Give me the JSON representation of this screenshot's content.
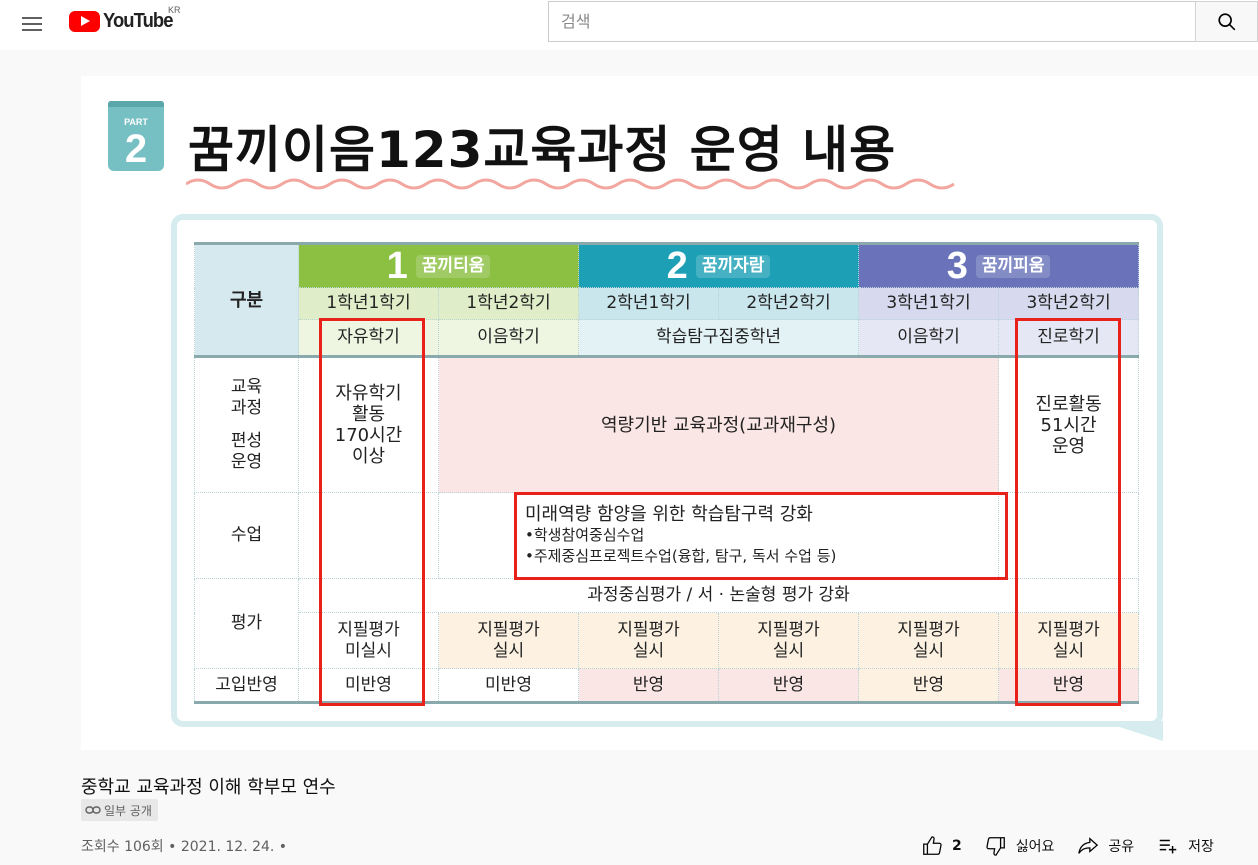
{
  "header": {
    "logo_text": "YouTube",
    "country_code": "KR",
    "search_placeholder": "검색"
  },
  "slide": {
    "part_label": "PART",
    "part_number": "2",
    "title": "꿈끼이음123교육과정 운영 내용",
    "table": {
      "corner": "구분",
      "grades": [
        {
          "num": "1",
          "name": "꿈끼티움"
        },
        {
          "num": "2",
          "name": "꿈끼자람"
        },
        {
          "num": "3",
          "name": "꿈끼피움"
        }
      ],
      "semesters": [
        "1학년1학기",
        "1학년2학기",
        "2학년1학기",
        "2학년2학기",
        "3학년1학기",
        "3학년2학기"
      ],
      "semester_types": [
        "자유학기",
        "이음학기",
        "학습탐구집중학년",
        "이음학기",
        "진로학기"
      ],
      "row_curriculum": {
        "label_line1": "교육",
        "label_line2": "과정",
        "label_line3": "편성",
        "label_line4": "운영",
        "free_sem": [
          "자유학기",
          "활동",
          "170시간",
          "이상"
        ],
        "center": "역량기반 교육과정(교과재구성)",
        "career": [
          "진로활동",
          "51시간",
          "운영"
        ]
      },
      "row_class": {
        "label": "수업",
        "heading": "미래역량 함양을 위한 학습탐구력 강화",
        "bullet1": "•학생참여중심수업",
        "bullet2": "•주제중심프로젝트수업(융합, 탐구, 독서 수업 등)"
      },
      "row_eval": {
        "label": "평가",
        "banner": "과정중심평가 / 서 · 논술형 평가 강화",
        "cells": [
          [
            "지필평가",
            "미실시"
          ],
          [
            "지필평가",
            "실시"
          ],
          [
            "지필평가",
            "실시"
          ],
          [
            "지필평가",
            "실시"
          ],
          [
            "지필평가",
            "실시"
          ],
          [
            "지필평가",
            "실시"
          ]
        ]
      },
      "row_admission": {
        "label": "고입반영",
        "cells": [
          "미반영",
          "미반영",
          "반영",
          "반영",
          "반영",
          "반영"
        ]
      }
    }
  },
  "video": {
    "title": "중학교 교육과정 이해 학부모 연수",
    "privacy": "일부 공개",
    "meta": "조회수 106회 • 2021. 12. 24. •",
    "like_count": "2",
    "dislike_label": "싫어요",
    "share_label": "공유",
    "save_label": "저장"
  },
  "colors": {
    "brand_red": "#ff0000",
    "highlight_red": "#e8211b",
    "grade1": "#8cc043",
    "grade2": "#1da0b5",
    "grade3": "#6a73b9"
  }
}
